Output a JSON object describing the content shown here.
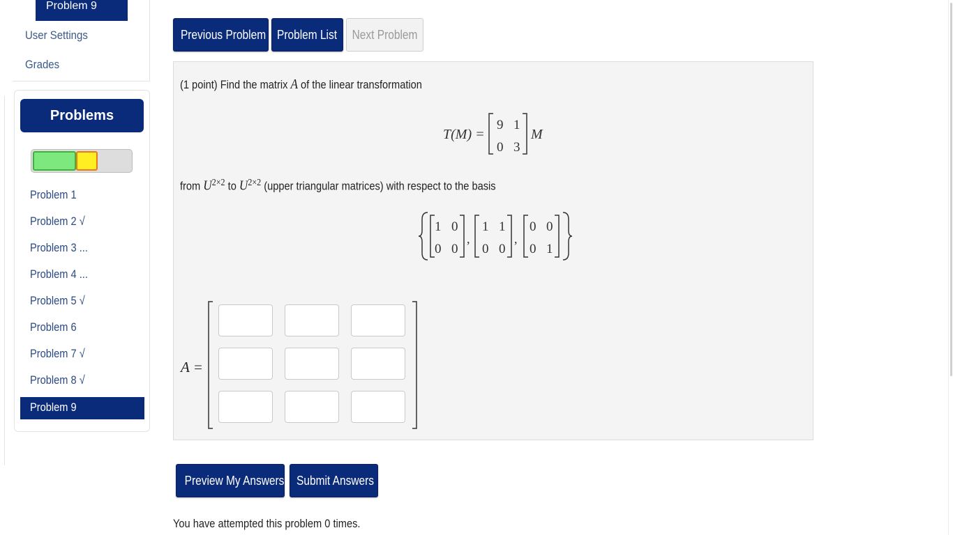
{
  "top_nav": {
    "active_problem": "Problem 9",
    "user_settings": "User Settings",
    "grades": "Grades"
  },
  "sidebar": {
    "header": "Problems",
    "progress": {
      "correct_fraction": 0.44,
      "partial_fraction": 0.22
    },
    "colors": {
      "header": "#0a2a7a",
      "correct": "#7de87d",
      "partial": "#ffee22"
    },
    "items": [
      {
        "label": "Problem 1"
      },
      {
        "label": "Problem 2 √"
      },
      {
        "label": "Problem 3 ..."
      },
      {
        "label": "Problem 4 ..."
      },
      {
        "label": "Problem 5 √"
      },
      {
        "label": "Problem 6"
      },
      {
        "label": "Problem 7 √"
      },
      {
        "label": "Problem 8 √"
      },
      {
        "label": "Problem 9"
      }
    ]
  },
  "nav_buttons": {
    "previous": "Previous Problem",
    "list": "Problem List",
    "next": "Next Problem"
  },
  "problem": {
    "intro_pre": "(1 point) Find the matrix ",
    "intro_var": "A",
    "intro_post": " of the linear transformation",
    "transform_lhs": "T(M) =",
    "transform_matrix": [
      "9",
      "1",
      "0",
      "3"
    ],
    "transform_rhs": "M",
    "from_word": "from ",
    "space_a": "U",
    "space_a_sup": "2×2",
    "to_word": " to ",
    "space_b": "U",
    "space_b_sup": "2×2",
    "from_post": " (upper triangular matrices) with respect to the basis",
    "basis": [
      [
        "1",
        "0",
        "0",
        "0"
      ],
      [
        "1",
        "1",
        "0",
        "0"
      ],
      [
        "0",
        "0",
        "0",
        "1"
      ]
    ],
    "answer_label": "A =",
    "answer_values": [
      "",
      "",
      "",
      "",
      "",
      "",
      "",
      "",
      ""
    ]
  },
  "action_buttons": {
    "preview": "Preview My Answers",
    "submit": "Submit Answers"
  },
  "attempts_text": "You have attempted this problem 0 times."
}
